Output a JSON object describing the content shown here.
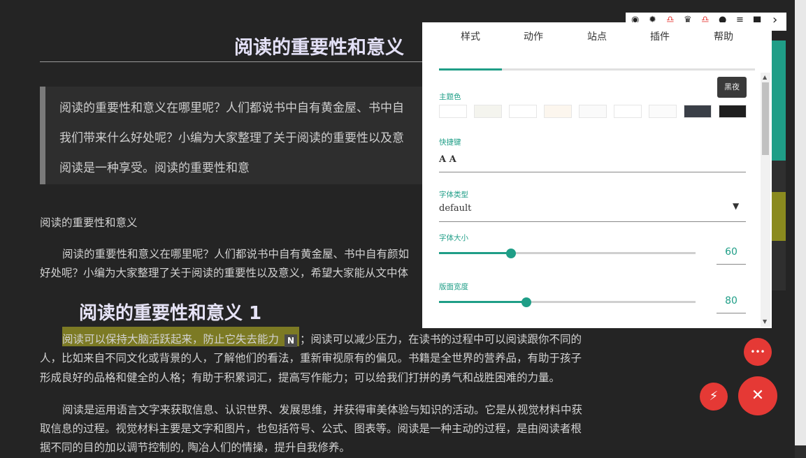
{
  "article": {
    "title": "阅读的重要性和意义",
    "quote_lines": [
      "阅读的重要性和意义在哪里呢？人们都说书中自有黄金屋、书中自",
      "我们带来什么好处呢？小编为大家整理了关于阅读的重要性以及意",
      "阅读是一种享受。阅读的重要性和意"
    ],
    "section_label": "阅读的重要性和意义",
    "intro_lines": [
      "阅读的重要性和意义在哪里呢？人们都说书中自有黄金屋、书中自有颜如",
      "好处呢？小编为大家整理了关于阅读的重要性以及意义，希望大家能从文中体"
    ],
    "heading2": "阅读的重要性和意义 1",
    "para1_highlight": "阅读可以保持大脑活跃起来，防止它失去能力",
    "para1_badge": "N",
    "para1_rest": "；阅读可以减少压力，在读书的过程中可以阅读跟你不同的",
    "para1_lines": [
      "人，比如来自不同文化或背景的人，了解他们的看法，重新审视原有的偏见。书籍是全世界的营养品，有助于孩子",
      "形成良好的品格和健全的人格；有助于积累词汇，提高写作能力；可以给我们打拼的勇气和战胜困难的力量。"
    ],
    "para2_lines": [
      "阅读是运用语言文字来获取信息、认识世界、发展思维，并获得审美体验与知识的活动。它是从视觉材料中获",
      "取信息的过程。视觉材料主要是文字和图片，也包括符号、公式、图表等。阅读是一种主动的过程，是由阅读者根",
      "据不同的目的加以调节控制的, 陶冶人们的情操，提升自我修养。"
    ]
  },
  "panel": {
    "tabs": [
      "样式",
      "动作",
      "站点",
      "插件",
      "帮助"
    ],
    "active_tab": "样式",
    "theme_label": "主题色",
    "theme_colors": [
      "#ffffff",
      "#f4f4ee",
      "#ffffff",
      "#fcf6ee",
      "#fafafa",
      "#ffffff",
      "#fbfbfb",
      "#3a3f47",
      "#1f1f1f"
    ],
    "tooltip": "黑夜",
    "shortcut_label": "快捷键",
    "shortcut_value": "A A",
    "font_type_label": "字体类型",
    "font_type_value": "default",
    "font_size_label": "字体大小",
    "font_size_value": "60",
    "font_size_fraction": 0.28,
    "page_width_label": "版面宽度",
    "page_width_value": "80",
    "page_width_fraction": 0.34
  },
  "icons": {
    "toolbar": [
      "eye-icon",
      "gear-icon",
      "lock-icon",
      "bulb-icon",
      "lock-icon",
      "info-icon",
      "list-icon",
      "trash-icon",
      "chevron-right-icon"
    ],
    "toolbar_glyphs": [
      "◉",
      "✹",
      "♎",
      "♛",
      "♎",
      "●",
      "≡",
      "▆",
      "›"
    ]
  },
  "fabs": {
    "more_glyph": "•••",
    "light_glyph": "⚡",
    "close_glyph": "✕"
  },
  "colors": {
    "accent": "#1f9e87",
    "fab": "#e53935",
    "highlight": "#7c7a24"
  }
}
